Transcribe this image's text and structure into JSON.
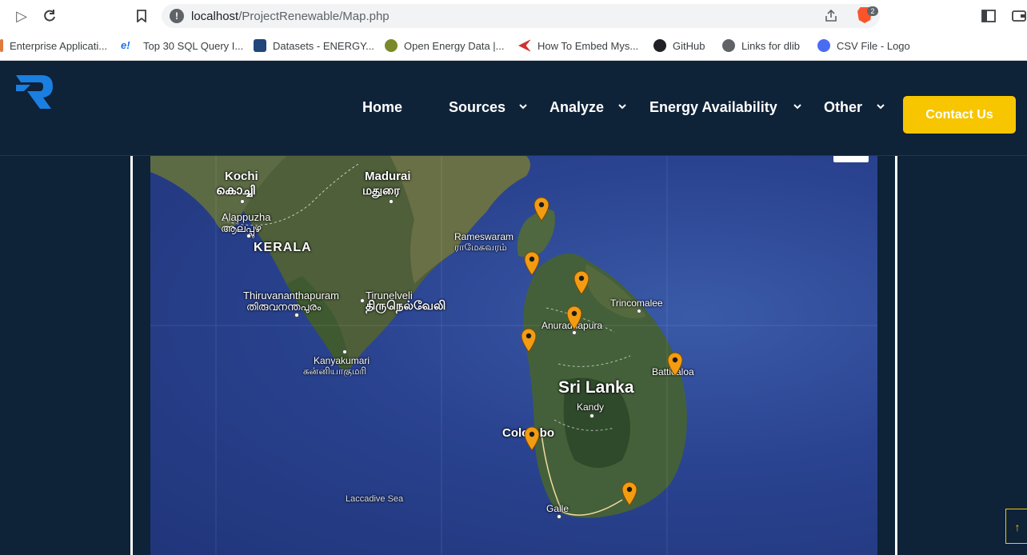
{
  "browser": {
    "url_host": "localhost",
    "url_path": "/ProjectRenewable/Map.php",
    "brave_count": "2"
  },
  "bookmarks": [
    {
      "label": "Enterprise Applicati...",
      "color": "#e07a3a"
    },
    {
      "label": "Top 30 SQL Query I...",
      "color": "#1a73e8"
    },
    {
      "label": "Datasets - ENERGY...",
      "color": "#20467a"
    },
    {
      "label": "Open Energy Data |...",
      "color": "#7a8a2a"
    },
    {
      "label": "How To Embed Mys...",
      "color": "#d03030"
    },
    {
      "label": "GitHub",
      "color": "#202124"
    },
    {
      "label": "Links for dlib",
      "color": "#5f6368"
    },
    {
      "label": "CSV File - Logo",
      "color": "#4a6cf0"
    }
  ],
  "nav": {
    "home": "Home",
    "sources": "Sources",
    "analyze": "Analyze",
    "energy": "Energy Availability",
    "other": "Other",
    "contact": "Contact Us"
  },
  "map": {
    "labels": {
      "kochi": "Kochi",
      "kochi_ml": "കൊച്ചി",
      "madurai": "Madurai",
      "madurai_ta": "மதுரை",
      "alappuzha": "Alappuzha",
      "alappuzha_ml": "ആലപ്പുഴ",
      "kerala": "KERALA",
      "rameswaram": "Rameswaram",
      "rameswaram_ta": "ராமேசுவரம்",
      "thiruvananthapuram": "Thiruvananthapuram",
      "thiruvananthapuram_ml": "തിരുവനന്തപുരം",
      "tirunelveli": "Tirunelveli",
      "tirunelveli_ta": "திருநெல்வேலி",
      "kanyakumari": "Kanyakumari",
      "kanyakumari_ta": "கன்னியாகுமரி",
      "trincomalee": "Trincomalee",
      "anuradhapura": "Anuradhapura",
      "batticaloa": "Batticaloa",
      "srilanka": "Sri Lanka",
      "kandy": "Kandy",
      "colombo": "Colombo",
      "galle": "Galle",
      "laccadive": "Laccadive Sea"
    },
    "marker_count": 9
  },
  "colors": {
    "nav_bg": "#0e2238",
    "accent": "#f7c600",
    "marker": "#f39c12"
  },
  "scroll_top_icon": "↑"
}
